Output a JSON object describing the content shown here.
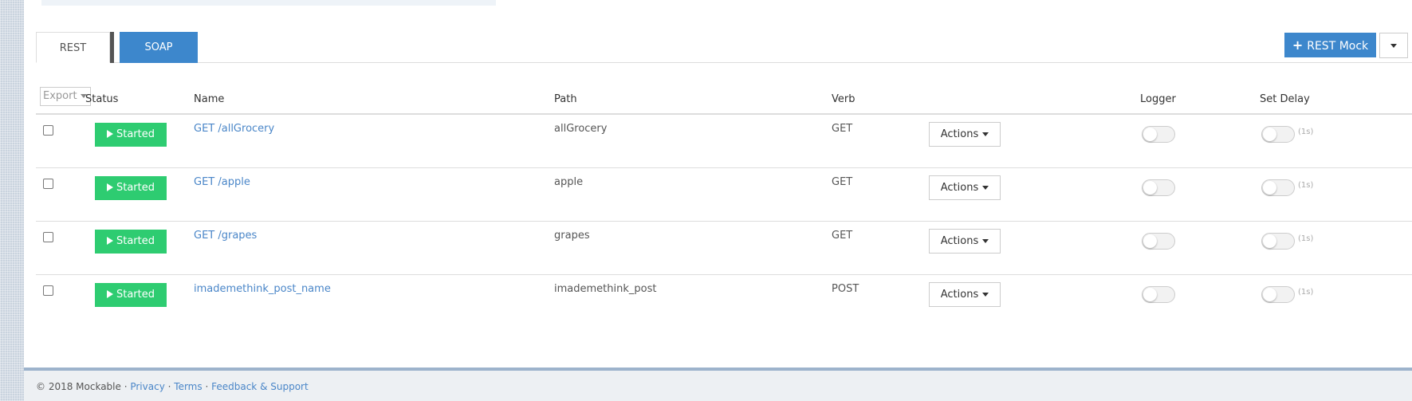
{
  "tabs": [
    {
      "label": "REST",
      "active": true
    },
    {
      "label": "SOAP",
      "active": false
    }
  ],
  "toolbar": {
    "add_mock_label": "REST Mock",
    "add_mock_icon": "plus-icon",
    "dropdown_icon": "caret-down-icon"
  },
  "table": {
    "export_label": "Export",
    "headers": {
      "status": "Status",
      "name": "Name",
      "path": "Path",
      "verb": "Verb",
      "logger": "Logger",
      "set_delay": "Set Delay"
    },
    "rows": [
      {
        "status": "Started",
        "name": "GET /allGrocery",
        "path": "allGrocery",
        "verb": "GET",
        "actions": "Actions",
        "logger_on": false,
        "delay_on": false,
        "delay_label": "(1s)"
      },
      {
        "status": "Started",
        "name": "GET /apple",
        "path": "apple",
        "verb": "GET",
        "actions": "Actions",
        "logger_on": false,
        "delay_on": false,
        "delay_label": "(1s)"
      },
      {
        "status": "Started",
        "name": "GET /grapes",
        "path": "grapes",
        "verb": "GET",
        "actions": "Actions",
        "logger_on": false,
        "delay_on": false,
        "delay_label": "(1s)"
      },
      {
        "status": "Started",
        "name": "imademethink_post_name",
        "path": "imademethink_post",
        "verb": "POST",
        "actions": "Actions",
        "logger_on": false,
        "delay_on": false,
        "delay_label": "(1s)"
      }
    ]
  },
  "footer": {
    "copyright": "© 2018 Mockable ·",
    "links": [
      "Privacy",
      "Terms",
      "Feedback & Support"
    ],
    "separator": "·"
  },
  "colors": {
    "primary": "#3d87cc",
    "success": "#2ecc71",
    "link": "#4a86c8"
  }
}
